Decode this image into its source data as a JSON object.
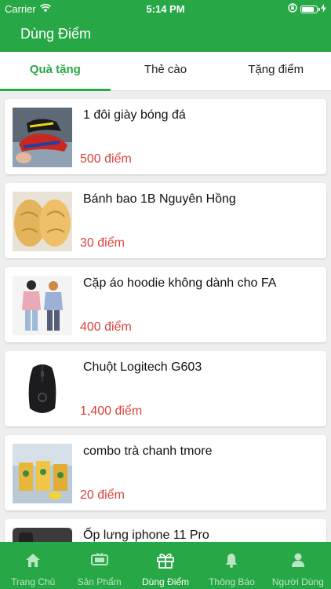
{
  "status_bar": {
    "carrier": "Carrier",
    "time": "5:14 PM",
    "battery_level": 0.9
  },
  "app_bar": {
    "title": "Dùng Điểm"
  },
  "tabs": [
    {
      "label": "Quà tặng",
      "active": true
    },
    {
      "label": "Thẻ cào",
      "active": false
    },
    {
      "label": "Tặng điểm",
      "active": false
    }
  ],
  "products": [
    {
      "name": "1 đôi giày bóng đá",
      "price": "500 điểm",
      "image_icon": "soccer-shoes-photo"
    },
    {
      "name": "Bánh bao 1B Nguyên Hồng",
      "price": "30 điểm",
      "image_icon": "bun-photo"
    },
    {
      "name": "Cặp áo hoodie không dành cho FA",
      "price": "400 điểm",
      "image_icon": "hoodie-couple-photo"
    },
    {
      "name": "Chuột Logitech G603",
      "price": "1,400 điểm",
      "image_icon": "mouse-photo"
    },
    {
      "name": "combo trà chanh tmore",
      "price": "20 điểm",
      "image_icon": "lemon-tea-photo"
    },
    {
      "name": "Ốp lưng iphone 11 Pro",
      "price": "",
      "image_icon": "phone-case-photo"
    }
  ],
  "bottom_nav": [
    {
      "label": "Trang Chủ",
      "icon": "home-icon",
      "active": false
    },
    {
      "label": "Sản Phẩm",
      "icon": "products-icon",
      "active": false
    },
    {
      "label": "Dùng Điểm",
      "icon": "gift-icon",
      "active": true
    },
    {
      "label": "Thông Báo",
      "icon": "bell-icon",
      "active": false
    },
    {
      "label": "Người Dùng",
      "icon": "user-icon",
      "active": false
    }
  ],
  "colors": {
    "primary": "#27a745",
    "price": "#d9443b",
    "background": "#eeeeee"
  }
}
